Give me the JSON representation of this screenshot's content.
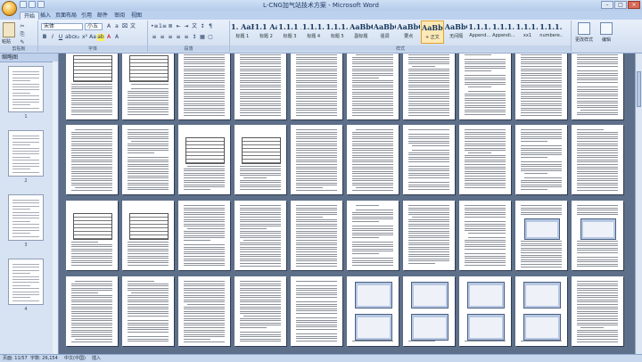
{
  "window": {
    "title": "L-CNG加气站技术方案 - Microsoft Word",
    "buttons": [
      "–",
      "□",
      "×"
    ]
  },
  "tabs": [
    "开始",
    "插入",
    "页面布局",
    "引用",
    "邮件",
    "审阅",
    "视图"
  ],
  "active_tab": "开始",
  "ribbon": {
    "clipboard": {
      "paste_label": "粘贴",
      "group_label": "剪贴板"
    },
    "font": {
      "font_name": "宋体",
      "font_size": "小五",
      "group_label": "字体"
    },
    "paragraph": {
      "group_label": "段落"
    },
    "styles": {
      "group_label": "样式",
      "items": [
        {
          "sample": "1. AaE",
          "name": "标题 1"
        },
        {
          "sample": "1.1 Aa",
          "name": "标题 2"
        },
        {
          "sample": "1.1.1 A",
          "name": "标题 3"
        },
        {
          "sample": "1.1.1.1",
          "name": "标题 4"
        },
        {
          "sample": "1.1.1.1.1",
          "name": "标题 5"
        },
        {
          "sample": "AaBbC",
          "name": "副标题"
        },
        {
          "sample": "AaBbCcL",
          "name": "强调"
        },
        {
          "sample": "AaBbCc",
          "name": "要点"
        },
        {
          "sample": "AaBbCcL",
          "name": "+ 正文"
        },
        {
          "sample": "AaBbCcDc",
          "name": "无间隔"
        },
        {
          "sample": "1.1.1.1.1",
          "name": "Append..."
        },
        {
          "sample": "1.1.1.1.1",
          "name": "Appendi..."
        },
        {
          "sample": "1.1.1.1.1",
          "name": "xx1"
        },
        {
          "sample": "1.1.1.1.1",
          "name": "numbere..."
        }
      ]
    },
    "change_styles_label": "更改样式",
    "editing_label": "编辑"
  },
  "left_pane": {
    "title": "缩略图",
    "page_numbers": [
      "1",
      "2",
      "3",
      "4"
    ]
  },
  "statusbar": {
    "page": "页面: 11/57",
    "words": "字数: 26,154",
    "language": "中文(中国)",
    "insert_mode": "插入"
  }
}
